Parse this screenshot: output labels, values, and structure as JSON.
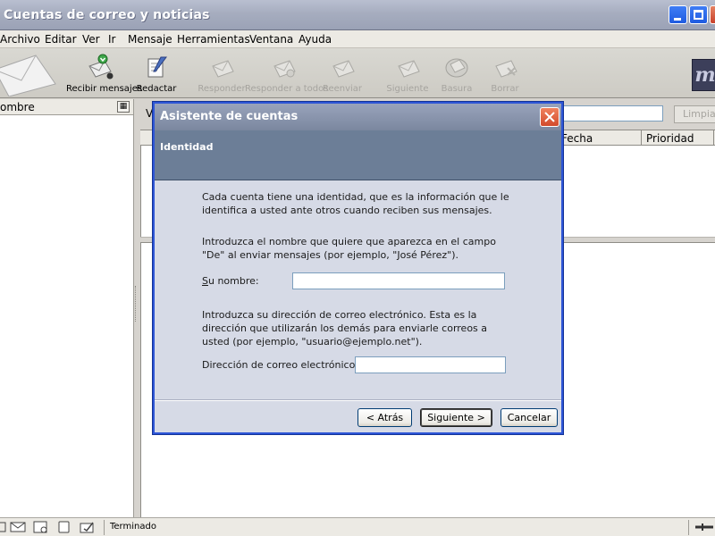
{
  "window": {
    "title": "Cuentas de correo y noticias"
  },
  "menu": [
    "Archivo",
    "Editar",
    "Ver",
    "Ir",
    "Mensaje",
    "Herramientas",
    "Ventana",
    "Ayuda"
  ],
  "toolbar": {
    "receive": "Recibir mensajes",
    "compose": "Redactar",
    "reply": "Responder",
    "reply_all": "Responder a todos",
    "forward": "Reenviar",
    "next": "Siguiente",
    "junk": "Basura",
    "delete": "Borrar"
  },
  "folder_pane": {
    "header": "ombre"
  },
  "search": {
    "prefix": "V",
    "clear_label": "Limpiar"
  },
  "message_list": {
    "columns": [
      "Fecha",
      "Prioridad"
    ]
  },
  "status": {
    "text": "Terminado"
  },
  "dialog": {
    "title": "Asistente de cuentas",
    "heading": "Identidad",
    "para1": "Cada cuenta tiene una identidad, que es la información que le identifica a usted ante otros cuando reciben sus mensajes.",
    "para2": "Introduzca el nombre que quiere que aparezca en el campo \"De\" al enviar mensajes (por ejemplo, \"José Pérez\").",
    "name_label": "Su nombre:",
    "name_value": "",
    "para3": "Introduzca su dirección de correo electrónico. Esta es la dirección que utilizarán los demás para enviarle correos a usted (por ejemplo, \"usuario@ejemplo.net\").",
    "email_label": "Dirección de correo electrónico:",
    "email_value": "",
    "back_button": "< Atrás",
    "next_button": "Siguiente >",
    "cancel_button": "Cancelar"
  }
}
